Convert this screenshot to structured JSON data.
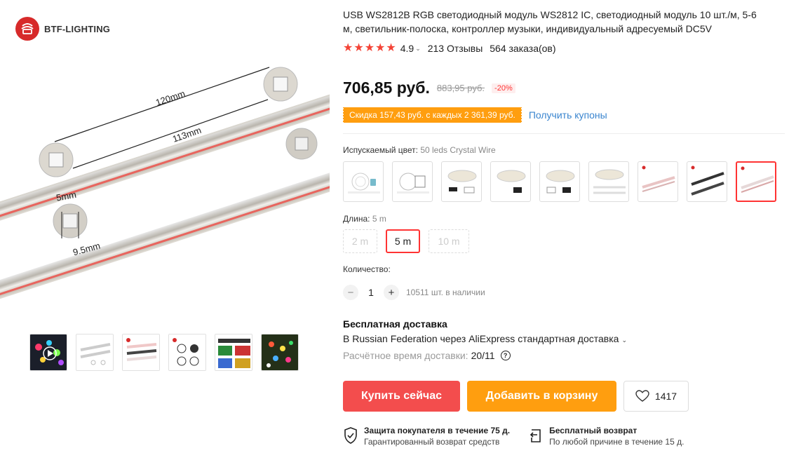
{
  "brand": {
    "name": "BTF-LIGHTING"
  },
  "main_image": {
    "annotations": [
      "120mm",
      "113mm",
      "5mm",
      "9.5mm"
    ]
  },
  "thumbnails": [
    {
      "icon": "product-photo-colorful-leds"
    },
    {
      "icon": "product-diagram-strips"
    },
    {
      "icon": "product-photo-three-strips"
    },
    {
      "icon": "product-diagram-modules"
    },
    {
      "icon": "product-infographic"
    },
    {
      "icon": "product-photo-tree-lights"
    }
  ],
  "product": {
    "title": "USB WS2812B RGB светодиодный модуль WS2812 IC, светодиодный модуль 10 шт./м, 5-6 м, светильник-полоска, контроллер музыки, индивидуальный адресуемый DC5V",
    "rating": "4.9",
    "reviews": "213 Отзывы",
    "orders": "564 заказа(ов)",
    "price": "706,85 руб.",
    "old_price": "883,95 руб.",
    "discount": "-20%",
    "coupon_text": "Скидка 157,43 руб. с каждых 2 361,39 руб.",
    "coupon_link": "Получить купоны"
  },
  "options": {
    "color_label": "Испускаемый цвет:",
    "color_value": "50 leds Crystal Wire",
    "color_count": 9,
    "selected_color_index": 8,
    "length_label": "Длина:",
    "length_value": "5 m",
    "lengths": [
      "2 m",
      "5 m",
      "10 m"
    ],
    "quantity_label": "Количество:",
    "quantity": "1",
    "stock": "10511 шт. в наличии",
    "qty_minus": "−",
    "qty_plus": "+"
  },
  "shipping": {
    "title": "Бесплатная доставка",
    "line": "В Russian Federation через AliExpress стандартная доставка",
    "time_label": "Расчётное время доставки:",
    "time_value": "20/11"
  },
  "actions": {
    "buy_now": "Купить сейчас",
    "add_to_cart": "Добавить в корзину",
    "wishlist_count": "1417"
  },
  "guarantees": [
    {
      "title": "Защита покупателя в течение 75 д.",
      "subtitle": "Гарантированный возврат средств",
      "icon": "shield-check-icon"
    },
    {
      "title": "Бесплатный возврат",
      "subtitle": "По любой причине в течение 15 д.",
      "icon": "return-arrow-icon"
    }
  ],
  "colors": {
    "accent": "#f34d4d",
    "orange": "#ff9e0f",
    "link": "#3a85cf",
    "star": "#f44336"
  }
}
